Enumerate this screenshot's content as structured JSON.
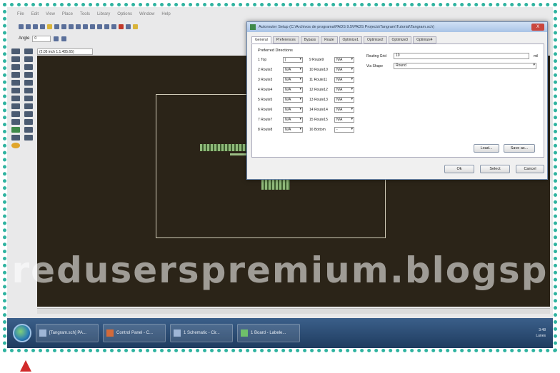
{
  "menubar": [
    "File",
    "Edit",
    "View",
    "Place",
    "Tools",
    "Library",
    "Options",
    "Window",
    "Help"
  ],
  "toolbar": {
    "angle_label": "Angle",
    "angle_value": "0"
  },
  "coord_readout": "(2.05 inch 1.1.405.65)",
  "dialog": {
    "title": "Autorouter Setup (C:\\Archivos de programa\\PADS 9.5\\PADS Projects\\Tangram\\Tutorial\\Tangram.sch)",
    "close": "X",
    "tabs": [
      "General",
      "Preferences",
      "Bypass",
      "Route",
      "Optimize1",
      "Optimize2",
      "Optimize3",
      "Optimize4"
    ],
    "group_title": "Preferred Directions",
    "left_layers": [
      {
        "name": "1 Top",
        "value": "|"
      },
      {
        "name": "2 Route2",
        "value": "N/A"
      },
      {
        "name": "3 Route3",
        "value": "N/A"
      },
      {
        "name": "4 Route4",
        "value": "N/A"
      },
      {
        "name": "5 Route5",
        "value": "N/A"
      },
      {
        "name": "6 Route6",
        "value": "N/A"
      },
      {
        "name": "7 Route7",
        "value": "N/A"
      },
      {
        "name": "8 Route8",
        "value": "N/A"
      }
    ],
    "right_layers": [
      {
        "name": "9 Route9",
        "value": "N/A"
      },
      {
        "name": "10 Route10",
        "value": "N/A"
      },
      {
        "name": "11 Route11",
        "value": "N/A"
      },
      {
        "name": "12 Route12",
        "value": "N/A"
      },
      {
        "name": "13 Route13",
        "value": "N/A"
      },
      {
        "name": "14 Route14",
        "value": "N/A"
      },
      {
        "name": "15 Route15",
        "value": "N/A"
      },
      {
        "name": "16 Bottom",
        "value": "-"
      }
    ],
    "routing_grid_label": "Routing Grid",
    "routing_grid_value": "10",
    "routing_grid_unit": "mil",
    "via_shape_label": "Via Shape",
    "via_shape_value": "Round",
    "load_button": "Load...",
    "save_as_button": "Save as...",
    "ok_button": "Ok",
    "select_button": "Select",
    "cancel_button": "Cancel"
  },
  "watermark": "reduserspremium.blogsp",
  "taskbar": {
    "items": [
      "[Tangram.sch] PA...",
      "Control Panel - C...",
      "1 Schematic - Cir...",
      "1 Board - Labele..."
    ],
    "time": "3:48",
    "day": "Lunes"
  }
}
